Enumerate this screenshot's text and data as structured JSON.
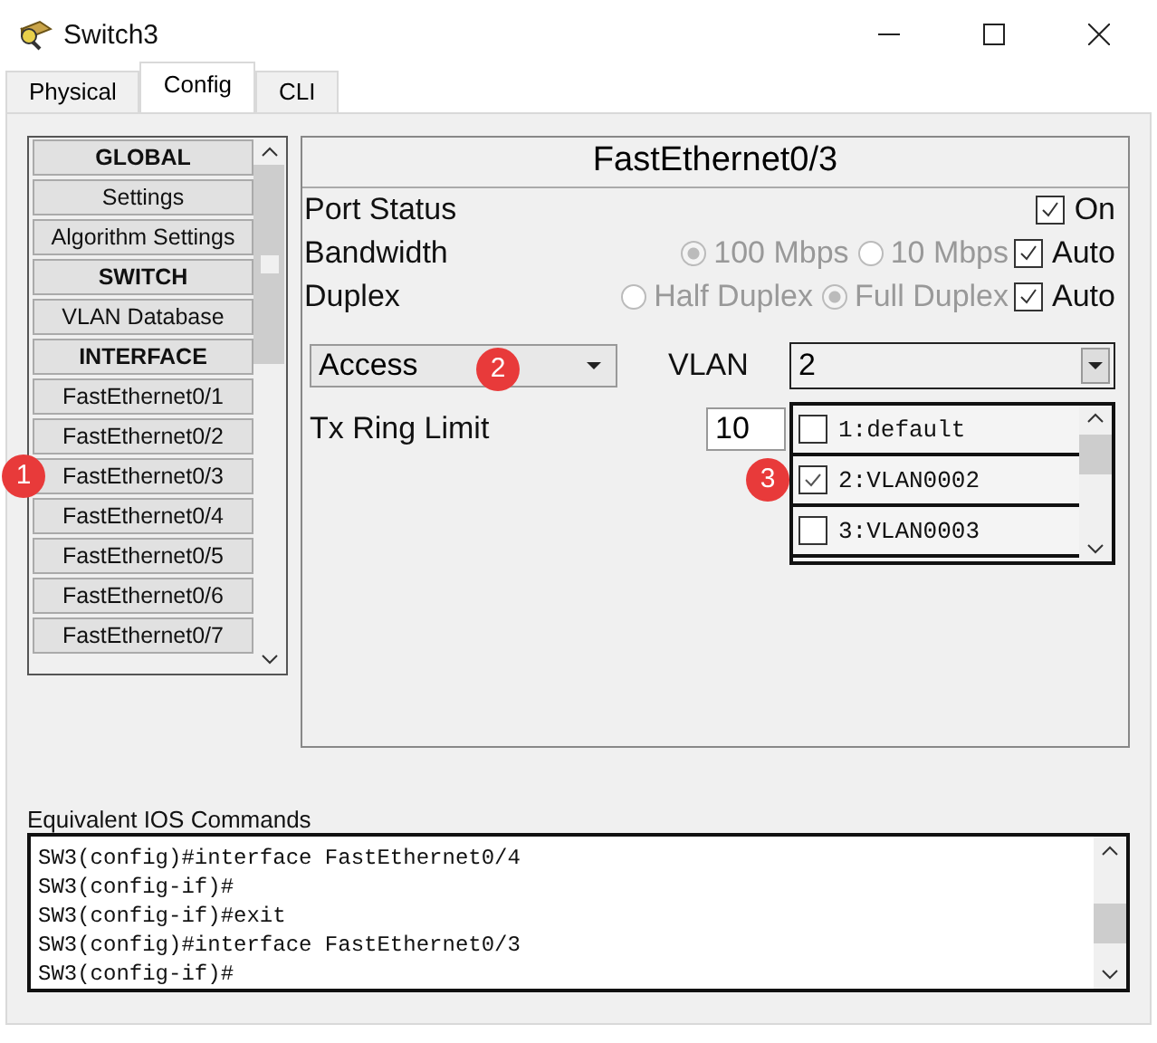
{
  "window": {
    "title": "Switch3"
  },
  "tabs": [
    {
      "label": "Physical",
      "selected": false
    },
    {
      "label": "Config",
      "selected": true
    },
    {
      "label": "CLI",
      "selected": false
    }
  ],
  "sidebar": {
    "items": [
      {
        "label": "GLOBAL",
        "kind": "header"
      },
      {
        "label": "Settings",
        "kind": "item"
      },
      {
        "label": "Algorithm Settings",
        "kind": "item"
      },
      {
        "label": "SWITCH",
        "kind": "header"
      },
      {
        "label": "VLAN Database",
        "kind": "item"
      },
      {
        "label": "INTERFACE",
        "kind": "header"
      },
      {
        "label": "FastEthernet0/1",
        "kind": "item"
      },
      {
        "label": "FastEthernet0/2",
        "kind": "item"
      },
      {
        "label": "FastEthernet0/3",
        "kind": "item"
      },
      {
        "label": "FastEthernet0/4",
        "kind": "item"
      },
      {
        "label": "FastEthernet0/5",
        "kind": "item"
      },
      {
        "label": "FastEthernet0/6",
        "kind": "item"
      },
      {
        "label": "FastEthernet0/7",
        "kind": "item"
      }
    ]
  },
  "port": {
    "title": "FastEthernet0/3",
    "port_status": {
      "label": "Port Status",
      "on": {
        "label": "On",
        "checked": true
      }
    },
    "bandwidth": {
      "label": "Bandwidth",
      "disabled": true,
      "options": [
        {
          "label": "100 Mbps",
          "selected": true
        },
        {
          "label": "10 Mbps",
          "selected": false
        }
      ],
      "auto": {
        "label": "Auto",
        "checked": true
      }
    },
    "duplex": {
      "label": "Duplex",
      "disabled": true,
      "options": [
        {
          "label": "Half Duplex",
          "selected": false
        },
        {
          "label": "Full Duplex",
          "selected": true
        }
      ],
      "auto": {
        "label": "Auto",
        "checked": true
      }
    },
    "mode": {
      "value": "Access"
    },
    "vlan": {
      "label": "VLAN",
      "value": "2",
      "options": [
        {
          "label": "1:default",
          "checked": false
        },
        {
          "label": "2:VLAN0002",
          "checked": true
        },
        {
          "label": "3:VLAN0003",
          "checked": false
        }
      ]
    },
    "tx_ring_limit": {
      "label": "Tx Ring Limit",
      "value": "10"
    }
  },
  "commands": {
    "label": "Equivalent IOS Commands",
    "lines": [
      "SW3(config)#interface FastEthernet0/4",
      "SW3(config-if)#",
      "SW3(config-if)#exit",
      "SW3(config)#interface FastEthernet0/3",
      "SW3(config-if)#"
    ]
  },
  "annotations": [
    {
      "number": "1"
    },
    {
      "number": "2"
    },
    {
      "number": "3"
    }
  ]
}
